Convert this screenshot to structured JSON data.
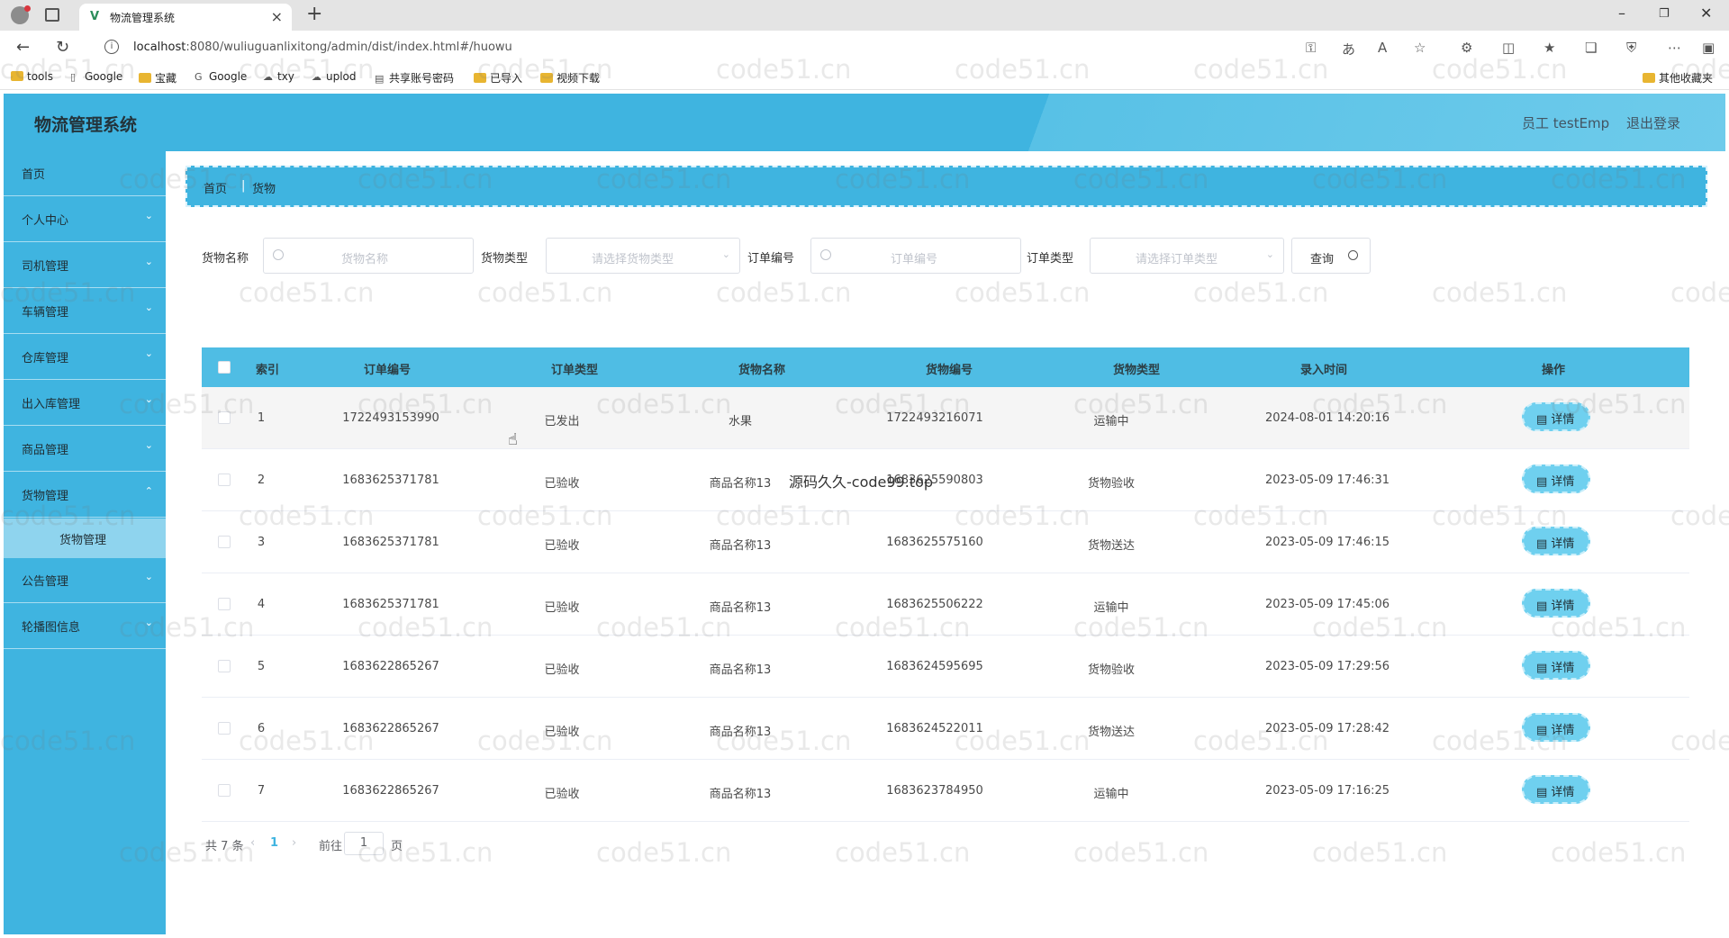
{
  "browser": {
    "tab_title": "物流管理系统",
    "url_host": "localhost",
    "url_rest": ":8080/wuliuguanlixitong/admin/dist/index.html#/huowu",
    "bookmarks": [
      "tools",
      "Google",
      "宝藏",
      "Google",
      "txy",
      "uplod",
      "共享账号密码",
      "已导入",
      "视频下载"
    ],
    "other_bookmarks": "其他收藏夹"
  },
  "header": {
    "title": "物流管理系统",
    "user": "员工 testEmp",
    "logout": "退出登录"
  },
  "sidebar": {
    "items": [
      "首页",
      "个人中心",
      "司机管理",
      "车辆管理",
      "仓库管理",
      "出入库管理",
      "商品管理",
      "货物管理",
      "公告管理",
      "轮播图信息"
    ],
    "active_sub": "货物管理"
  },
  "breadcrumb": [
    "首页",
    "货物"
  ],
  "filters": {
    "goods_name_label": "货物名称",
    "goods_name_placeholder": "货物名称",
    "goods_type_label": "货物类型",
    "goods_type_placeholder": "请选择货物类型",
    "order_no_label": "订单编号",
    "order_no_placeholder": "订单编号",
    "order_type_label": "订单类型",
    "order_type_placeholder": "请选择订单类型",
    "query_button": "查询"
  },
  "table": {
    "headers": [
      "索引",
      "订单编号",
      "订单类型",
      "货物名称",
      "货物编号",
      "货物类型",
      "录入时间",
      "操作"
    ],
    "detail_label": "详情",
    "rows": [
      {
        "index": "1",
        "order_no": "1722493153990",
        "order_type": "已发出",
        "goods_name": "水果",
        "goods_no": "1722493216071",
        "goods_type": "运输中",
        "time": "2024-08-01 14:20:16"
      },
      {
        "index": "2",
        "order_no": "1683625371781",
        "order_type": "已验收",
        "goods_name": "商品名称13",
        "goods_no": "1683625590803",
        "goods_type": "货物验收",
        "time": "2023-05-09 17:46:31"
      },
      {
        "index": "3",
        "order_no": "1683625371781",
        "order_type": "已验收",
        "goods_name": "商品名称13",
        "goods_no": "1683625575160",
        "goods_type": "货物送达",
        "time": "2023-05-09 17:46:15"
      },
      {
        "index": "4",
        "order_no": "1683625371781",
        "order_type": "已验收",
        "goods_name": "商品名称13",
        "goods_no": "1683625506222",
        "goods_type": "运输中",
        "time": "2023-05-09 17:45:06"
      },
      {
        "index": "5",
        "order_no": "1683622865267",
        "order_type": "已验收",
        "goods_name": "商品名称13",
        "goods_no": "1683624595695",
        "goods_type": "货物验收",
        "time": "2023-05-09 17:29:56"
      },
      {
        "index": "6",
        "order_no": "1683622865267",
        "order_type": "已验收",
        "goods_name": "商品名称13",
        "goods_no": "1683624522011",
        "goods_type": "货物送达",
        "time": "2023-05-09 17:28:42"
      },
      {
        "index": "7",
        "order_no": "1683622865267",
        "order_type": "已验收",
        "goods_name": "商品名称13",
        "goods_no": "1683623784950",
        "goods_type": "运输中",
        "time": "2023-05-09 17:16:25"
      }
    ]
  },
  "pager": {
    "total": "共 7 条",
    "current_page": "1",
    "goto_label": "前往",
    "goto_value": "1",
    "page_suffix": "页"
  },
  "overlay_text": "源码久久-code99.top",
  "watermark_text": "code51.cn",
  "colors": {
    "primary": "#3fb4e0",
    "table_header": "#4fbde4",
    "detail_button": "#6fd0ef"
  }
}
